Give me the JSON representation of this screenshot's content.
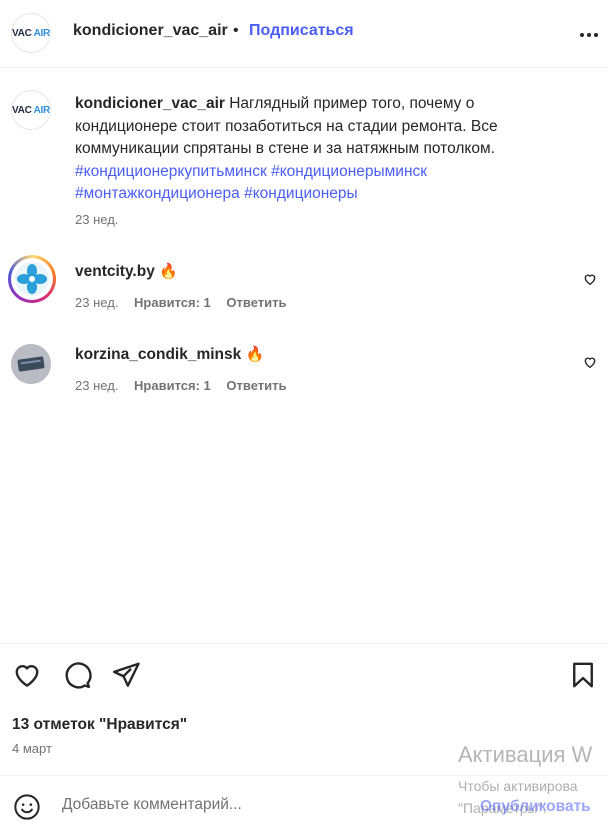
{
  "header": {
    "logo": {
      "vac": "VAC",
      "air": "AIR"
    },
    "username": "kondicioner_vac_air",
    "dot": "•",
    "follow_label": "Подписаться",
    "more_icon": "more-horizontal-icon"
  },
  "caption": {
    "username": "kondicioner_vac_air",
    "text": "Наглядный пример того, почему о кондиционере стоит позаботиться на стадии ремонта. Все коммуникации спрятаны в стене и за натяжным потолком.",
    "hashtags": [
      "#кондиционеркупитьминск",
      "#кондиционерыминск",
      "#монтажкондиционера",
      "#кондиционеры"
    ],
    "time": "23 нед."
  },
  "comments": [
    {
      "username": "ventcity.by",
      "text": "🔥",
      "time": "23 нед.",
      "likes": "Нравится: 1",
      "reply": "Ответить"
    },
    {
      "username": "korzina_condik_minsk",
      "text": "🔥",
      "time": "23 нед.",
      "likes": "Нравится: 1",
      "reply": "Ответить"
    }
  ],
  "actions": {
    "like_icon": "heart-icon",
    "comment_icon": "comment-icon",
    "share_icon": "send-icon",
    "save_icon": "bookmark-icon"
  },
  "likes_text": "13 отметок \"Нравится\"",
  "date": "4 март",
  "comment_bar": {
    "emoji_icon": "emoji-icon",
    "placeholder": "Добавьте комментарий...",
    "publish_label": "Опубликовать"
  },
  "windows_watermark": {
    "title": "Активация W",
    "line1": "Чтобы активирова",
    "line2": "\"Параметры\"."
  },
  "colors": {
    "link_blue": "#4a5df5",
    "text": "#262626",
    "muted": "#737373",
    "divider": "#efefef"
  }
}
